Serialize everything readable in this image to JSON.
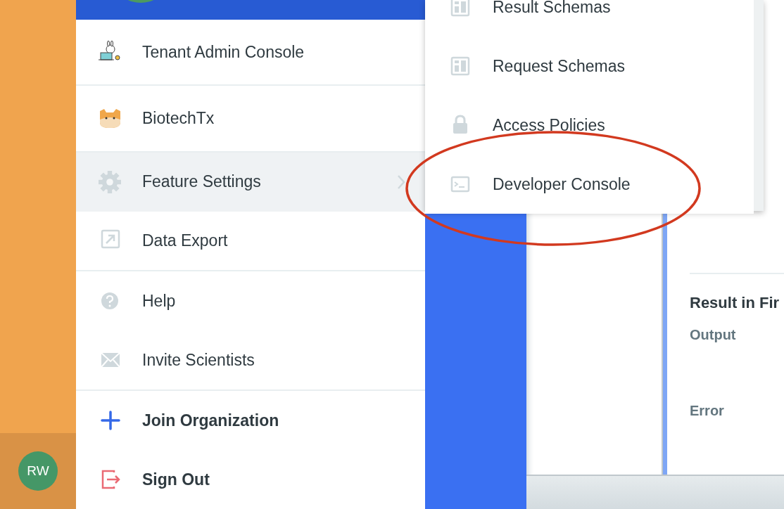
{
  "sidebar": {
    "avatar_initials": "RW"
  },
  "menu": {
    "items": [
      {
        "kind": "workspace",
        "label": "Tenant Admin Console",
        "selected": false,
        "bold": false,
        "submenu": false,
        "divider_after": true
      },
      {
        "kind": "workspace",
        "label": "BiotechTx",
        "selected": false,
        "bold": false,
        "submenu": false,
        "divider_after": true
      },
      {
        "kind": "setting",
        "label": "Feature Settings",
        "selected": true,
        "bold": false,
        "submenu": true,
        "divider_after": false
      },
      {
        "kind": "setting",
        "label": "Data Export",
        "selected": false,
        "bold": false,
        "submenu": false,
        "divider_after": true
      },
      {
        "kind": "setting",
        "label": "Help",
        "selected": false,
        "bold": false,
        "submenu": false,
        "divider_after": false
      },
      {
        "kind": "setting",
        "label": "Invite Scientists",
        "selected": false,
        "bold": false,
        "submenu": false,
        "divider_after": true
      },
      {
        "kind": "action",
        "label": "Join Organization",
        "selected": false,
        "bold": true,
        "submenu": false,
        "divider_after": false
      },
      {
        "kind": "action",
        "label": "Sign Out",
        "selected": false,
        "bold": true,
        "submenu": false,
        "divider_after": false
      }
    ]
  },
  "submenu": {
    "items": [
      {
        "label": "Result Schemas",
        "circled": false
      },
      {
        "label": "Request Schemas",
        "circled": false
      },
      {
        "label": "Access Policies",
        "circled": false
      },
      {
        "label": "Developer Console",
        "circled": true
      }
    ]
  },
  "content": {
    "heading": "Result in Fir",
    "fields": [
      {
        "label": "Output"
      },
      {
        "label": "Error"
      }
    ]
  }
}
